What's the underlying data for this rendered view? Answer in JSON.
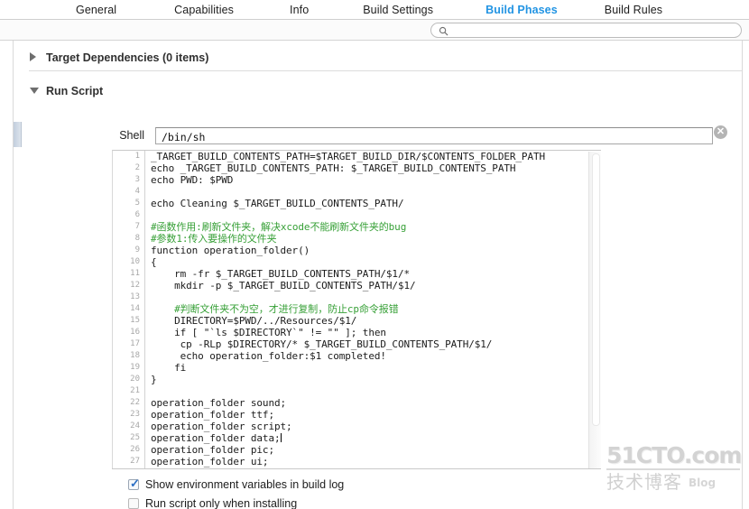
{
  "tabs": [
    {
      "label": "General",
      "selected": false
    },
    {
      "label": "Capabilities",
      "selected": false
    },
    {
      "label": "Info",
      "selected": false
    },
    {
      "label": "Build Settings",
      "selected": false
    },
    {
      "label": "Build Phases",
      "selected": true
    },
    {
      "label": "Build Rules",
      "selected": false
    }
  ],
  "search": {
    "value": "",
    "placeholder": "",
    "icon": "search-icon"
  },
  "sections": [
    {
      "id": "target-dependencies",
      "title": "Target Dependencies (0 items)",
      "expanded": false,
      "disclosure_icon": "triangle-right-icon"
    },
    {
      "id": "run-script",
      "title": "Run Script",
      "expanded": true,
      "disclosure_icon": "triangle-down-icon"
    }
  ],
  "run_script": {
    "delete_button": {
      "icon": "close-circle-icon",
      "label": "✕"
    },
    "shell": {
      "label": "Shell",
      "value": "/bin/sh",
      "placeholder": "/bin/sh"
    },
    "editor": {
      "line_count": 27,
      "line_numbers": [
        "1",
        "2",
        "3",
        "4",
        "5",
        "6",
        "7",
        "8",
        "9",
        "10",
        "11",
        "12",
        "13",
        "14",
        "15",
        "16",
        "17",
        "18",
        "19",
        "20",
        "21",
        "22",
        "23",
        "24",
        "25",
        "26",
        "27"
      ],
      "caret_line": 25,
      "lines": [
        {
          "n": 1,
          "text": "_TARGET_BUILD_CONTENTS_PATH=$TARGET_BUILD_DIR/$CONTENTS_FOLDER_PATH",
          "kind": "plain"
        },
        {
          "n": 2,
          "text": "echo _TARGET_BUILD_CONTENTS_PATH: $_TARGET_BUILD_CONTENTS_PATH",
          "kind": "plain"
        },
        {
          "n": 3,
          "text": "echo PWD: $PWD",
          "kind": "plain"
        },
        {
          "n": 4,
          "text": "",
          "kind": "plain"
        },
        {
          "n": 5,
          "text": "echo Cleaning $_TARGET_BUILD_CONTENTS_PATH/",
          "kind": "plain"
        },
        {
          "n": 6,
          "text": "",
          "kind": "plain"
        },
        {
          "n": 7,
          "text": "#函数作用:刷新文件夹，解决xcode不能刷新文件夹的bug",
          "kind": "comment"
        },
        {
          "n": 8,
          "text": "#参数1:传入要操作的文件夹",
          "kind": "comment"
        },
        {
          "n": 9,
          "text": "function operation_folder()",
          "kind": "plain"
        },
        {
          "n": 10,
          "text": "{",
          "kind": "plain"
        },
        {
          "n": 11,
          "text": "    rm -fr $_TARGET_BUILD_CONTENTS_PATH/$1/*",
          "kind": "plain"
        },
        {
          "n": 12,
          "text": "    mkdir -p $_TARGET_BUILD_CONTENTS_PATH/$1/",
          "kind": "plain"
        },
        {
          "n": 13,
          "text": "",
          "kind": "plain"
        },
        {
          "n": 14,
          "text": "    #判断文件夹不为空，才进行复制，防止cp命令报错",
          "kind": "comment"
        },
        {
          "n": 15,
          "text": "    DIRECTORY=$PWD/../Resources/$1/",
          "kind": "plain"
        },
        {
          "n": 16,
          "text": "    if [ \"`ls $DIRECTORY`\" != \"\" ]; then",
          "kind": "plain"
        },
        {
          "n": 17,
          "text": "     cp -RLp $DIRECTORY/* $_TARGET_BUILD_CONTENTS_PATH/$1/",
          "kind": "plain"
        },
        {
          "n": 18,
          "text": "     echo operation_folder:$1 completed!",
          "kind": "plain"
        },
        {
          "n": 19,
          "text": "    fi",
          "kind": "plain"
        },
        {
          "n": 20,
          "text": "}",
          "kind": "plain"
        },
        {
          "n": 21,
          "text": "",
          "kind": "plain"
        },
        {
          "n": 22,
          "text": "operation_folder sound;",
          "kind": "plain"
        },
        {
          "n": 23,
          "text": "operation_folder ttf;",
          "kind": "plain"
        },
        {
          "n": 24,
          "text": "operation_folder script;",
          "kind": "plain"
        },
        {
          "n": 25,
          "text": "operation_folder data;",
          "kind": "plain"
        },
        {
          "n": 26,
          "text": "operation_folder pic;",
          "kind": "plain"
        },
        {
          "n": 27,
          "text": "operation_folder ui;",
          "kind": "plain"
        }
      ]
    },
    "options": [
      {
        "id": "show-env-vars",
        "label": "Show environment variables in build log",
        "checked": true,
        "mark": "✓"
      },
      {
        "id": "run-when-installing",
        "label": "Run script only when installing",
        "checked": false,
        "mark": ""
      }
    ]
  },
  "watermark": {
    "top": "51CTO.com",
    "bottom_cn": "技术博客",
    "bottom_en": "Blog"
  },
  "colors": {
    "accent": "#2294e3",
    "code_plain": "#1b1b1b",
    "code_comment": "#37a037",
    "gutter_text": "#a8a8a8"
  }
}
